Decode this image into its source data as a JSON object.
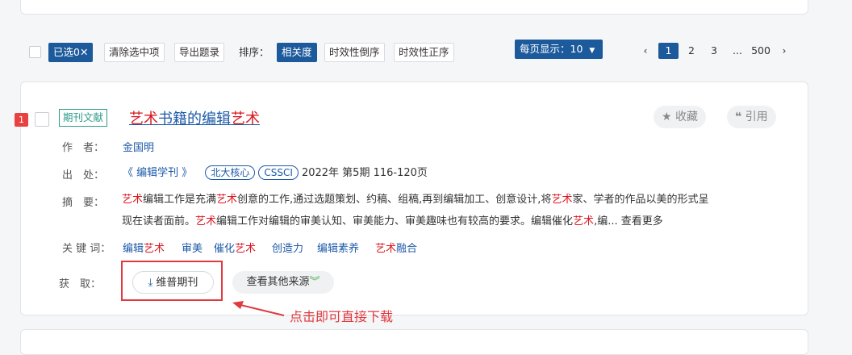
{
  "toolbar": {
    "selected_label": "已选0",
    "clear_label": "清除选中项",
    "export_label": "导出题录",
    "sort_label": "排序：",
    "sort_options": [
      "相关度",
      "时效性倒序",
      "时效性正序"
    ],
    "per_page_label": "每页显示：10",
    "pager": [
      "1",
      "2",
      "3",
      "...",
      "500"
    ]
  },
  "result": {
    "rank": "1",
    "type_tag": "期刊文献",
    "title_parts": [
      "艺术",
      "书籍的编辑",
      "艺术"
    ],
    "favorite_label": "收藏",
    "cite_label": "引用",
    "author_label": "作　者：",
    "author": "金国明",
    "source_label": "出　处：",
    "source": "《 编辑学刊 》",
    "core_tags": [
      "北大核心",
      "CSSCI"
    ],
    "issue": "2022年 第5期 116-120页",
    "abstract_label": "摘　要：",
    "abstract_html_parts": {
      "line1_a": "艺术",
      "line1_b": "编辑工作是充满",
      "line1_c": "艺术",
      "line1_d": "创意的工作,通过选题策划、约稿、组稿,再到编辑加工、创意设计,将",
      "line1_e": "艺术",
      "line1_f": "家、学者的作品以美的形式呈",
      "line2_a": "现在读者面前。",
      "line2_b": "艺术",
      "line2_c": "编辑工作对编辑的审美认知、审美能力、审美趣味也有较高的要求。编辑催化",
      "line2_d": "艺术",
      "line2_e": ",编...",
      "more": "查看更多"
    },
    "keywords_label": "关 键 词：",
    "keywords": [
      {
        "a": "编辑",
        "b": "艺术"
      },
      {
        "a": "审美",
        "b": ""
      },
      {
        "a": "催化",
        "b": "艺术"
      },
      {
        "a": "创造力",
        "b": ""
      },
      {
        "a": "编辑素养",
        "b": ""
      },
      {
        "a": "",
        "b": "艺术",
        "c": "融合"
      }
    ],
    "access_label": "获　取：",
    "download_label": "维普期刊",
    "other_source_label": "查看其他来源"
  },
  "annotation": {
    "text": "点击即可直接下载"
  },
  "colors": {
    "primary": "#1c5a9c",
    "highlight": "#d9171f",
    "annotation": "#e0393e"
  }
}
